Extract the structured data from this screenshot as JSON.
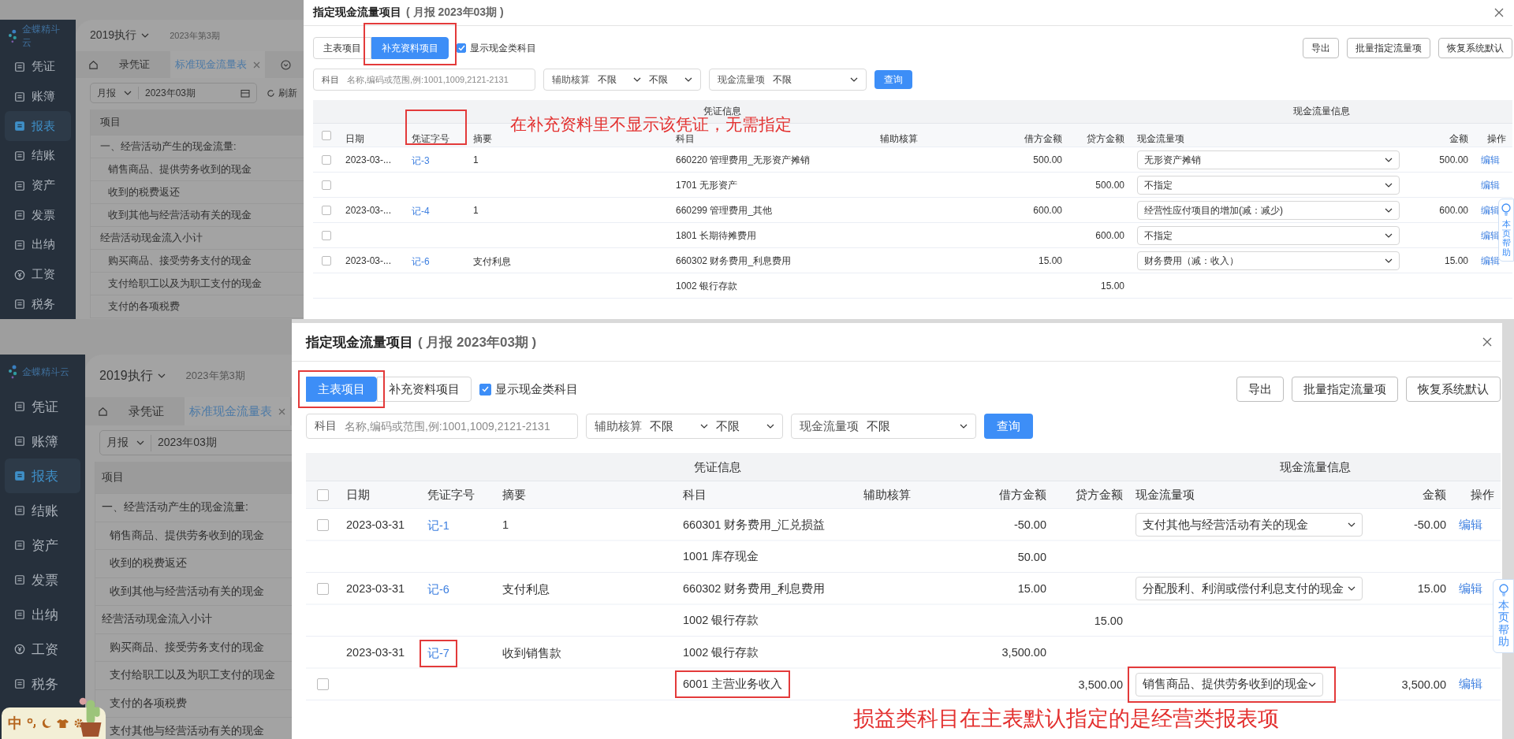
{
  "shots": [
    {
      "app": {
        "logo": "金蝶精斗云",
        "nav": [
          {
            "label": "凭证",
            "selected": false
          },
          {
            "label": "账簿",
            "selected": false
          },
          {
            "label": "报表",
            "selected": true
          },
          {
            "label": "结账",
            "selected": false
          },
          {
            "label": "资产",
            "selected": false
          },
          {
            "label": "发票",
            "selected": false
          },
          {
            "label": "出纳",
            "selected": false
          },
          {
            "label": "工资",
            "selected": false
          },
          {
            "label": "税务",
            "selected": false
          }
        ],
        "book": "2019执行",
        "period": "2023年第3期",
        "tabs": [
          {
            "label": "录凭证",
            "selected": false
          },
          {
            "label": "标准现金流量表",
            "selected": true
          }
        ],
        "report_type": "月报",
        "report_period": "2023年03期",
        "refresh": "刷新",
        "list_header": "项目",
        "items": [
          {
            "label": "一、经营活动产生的现金流量:",
            "kind": "total"
          },
          {
            "label": "销售商品、提供劳务收到的现金",
            "kind": "detail"
          },
          {
            "label": "收到的税费返还",
            "kind": "detail"
          },
          {
            "label": "收到其他与经营活动有关的现金",
            "kind": "detail"
          },
          {
            "label": "经营活动现金流入小计",
            "kind": "total"
          },
          {
            "label": "购买商品、接受劳务支付的现金",
            "kind": "detail"
          },
          {
            "label": "支付给职工以及为职工支付的现金",
            "kind": "detail"
          },
          {
            "label": "支付的各项税费",
            "kind": "detail"
          }
        ]
      },
      "dialog": {
        "title": "指定现金流量项目",
        "subtitle": "( 月报 2023年03期 )",
        "modes": [
          {
            "label": "主表项目",
            "selected": false,
            "marked": false
          },
          {
            "label": "补充资料项目",
            "selected": true,
            "marked": true
          }
        ],
        "show_cash": {
          "label": "显示现金类科目",
          "checked": true
        },
        "actions": [
          "导出",
          "批量指定流量项",
          "恢复系统默认"
        ],
        "filters": {
          "subject_label": "科目",
          "subject_placeholder": "名称,编码或范围,例:1001,1009,2121-2131",
          "aux_label": "辅助核算",
          "aux_values": [
            "不限",
            "不限"
          ],
          "flow_label": "现金流量项",
          "flow_value": "不限",
          "query": "查询"
        },
        "table": {
          "groups": [
            "凭证信息",
            "现金流量信息"
          ],
          "all_checked": false,
          "columns": [
            {
              "label": "日期",
              "marked": false
            },
            {
              "label": "凭证字号",
              "marked": true
            },
            {
              "label": "摘要",
              "marked": false
            },
            {
              "label": "科目",
              "marked": false
            },
            {
              "label": "辅助核算",
              "marked": false
            },
            {
              "label": "借方金额",
              "marked": false
            },
            {
              "label": "贷方金额",
              "marked": false
            },
            {
              "label": "现金流量项",
              "marked": false
            },
            {
              "label": "金额",
              "marked": false
            },
            {
              "label": "操作",
              "marked": false
            }
          ],
          "vouchers": [
            {
              "date": "2023-03-...",
              "number": "记-3",
              "number_marked": false,
              "summary": "1",
              "lines": [
                {
                  "checked": false,
                  "subject": "660220 管理费用_无形资产摊销",
                  "subject_marked": false,
                  "debit": "500.00",
                  "flow": "无形资产摊销",
                  "flow_marked": false,
                  "amount": "500.00",
                  "edit": "编辑"
                },
                {
                  "checked": false,
                  "subject": "1701 无形资产",
                  "subject_marked": false,
                  "credit": "500.00",
                  "flow": "不指定",
                  "flow_marked": false,
                  "edit": "编辑"
                }
              ]
            },
            {
              "date": "2023-03-...",
              "number": "记-4",
              "number_marked": false,
              "summary": "1",
              "lines": [
                {
                  "checked": false,
                  "subject": "660299 管理费用_其他",
                  "subject_marked": false,
                  "debit": "600.00",
                  "flow": "经营性应付项目的增加(减：减少)",
                  "flow_marked": false,
                  "amount": "600.00",
                  "edit": "编辑"
                },
                {
                  "checked": false,
                  "subject": "1801 长期待摊费用",
                  "subject_marked": false,
                  "credit": "600.00",
                  "flow": "不指定",
                  "flow_marked": false,
                  "edit": "编辑"
                }
              ]
            },
            {
              "date": "2023-03-...",
              "number": "记-6",
              "number_marked": false,
              "summary": "支付利息",
              "lines": [
                {
                  "checked": false,
                  "subject": "660302 财务费用_利息费用",
                  "subject_marked": false,
                  "debit": "15.00",
                  "flow": "财务费用（减：收入）",
                  "flow_marked": false,
                  "amount": "15.00",
                  "edit": "编辑"
                },
                {
                  "subject": "1002 银行存款",
                  "subject_marked": false,
                  "credit": "15.00"
                }
              ]
            }
          ]
        },
        "help": "本页帮助",
        "notes": [
          "在补充资料里不显示该凭证，无需指定"
        ]
      }
    },
    {
      "app": {
        "logo": "金蝶精斗云",
        "nav": [
          {
            "label": "凭证",
            "selected": false
          },
          {
            "label": "账簿",
            "selected": false
          },
          {
            "label": "报表",
            "selected": true
          },
          {
            "label": "结账",
            "selected": false
          },
          {
            "label": "资产",
            "selected": false
          },
          {
            "label": "发票",
            "selected": false
          },
          {
            "label": "出纳",
            "selected": false
          },
          {
            "label": "工资",
            "selected": false
          },
          {
            "label": "税务",
            "selected": false
          }
        ],
        "book": "2019执行",
        "period": "2023年第3期",
        "tabs": [
          {
            "label": "录凭证",
            "selected": false
          },
          {
            "label": "标准现金流量表",
            "selected": true
          }
        ],
        "report_type": "月报",
        "report_period": "2023年03期",
        "list_header": "项目",
        "items": [
          {
            "label": "一、经营活动产生的现金流量:",
            "kind": "total"
          },
          {
            "label": "销售商品、提供劳务收到的现金",
            "kind": "detail"
          },
          {
            "label": "收到的税费返还",
            "kind": "detail"
          },
          {
            "label": "收到其他与经营活动有关的现金",
            "kind": "detail"
          },
          {
            "label": "经营活动现金流入小计",
            "kind": "total"
          },
          {
            "label": "购买商品、接受劳务支付的现金",
            "kind": "detail"
          },
          {
            "label": "支付给职工以及为职工支付的现金",
            "kind": "detail"
          },
          {
            "label": "支付的各项税费",
            "kind": "detail"
          },
          {
            "label": "支付其他与经营活动有关的现金",
            "kind": "detail"
          }
        ],
        "ime": "中"
      },
      "dialog": {
        "title": "指定现金流量项目",
        "subtitle": "( 月报 2023年03期 )",
        "modes": [
          {
            "label": "主表项目",
            "selected": true,
            "marked": true
          },
          {
            "label": "补充资料项目",
            "selected": false,
            "marked": false
          }
        ],
        "show_cash": {
          "label": "显示现金类科目",
          "checked": true
        },
        "actions": [
          "导出",
          "批量指定流量项",
          "恢复系统默认"
        ],
        "filters": {
          "subject_label": "科目",
          "subject_placeholder": "名称,编码或范围,例:1001,1009,2121-2131",
          "aux_label": "辅助核算",
          "aux_values": [
            "不限",
            "不限"
          ],
          "flow_label": "现金流量项",
          "flow_value": "不限",
          "query": "查询"
        },
        "table": {
          "groups": [
            "凭证信息",
            "现金流量信息"
          ],
          "all_checked": false,
          "columns": [
            {
              "label": "日期",
              "marked": false
            },
            {
              "label": "凭证字号",
              "marked": false
            },
            {
              "label": "摘要",
              "marked": false
            },
            {
              "label": "科目",
              "marked": false
            },
            {
              "label": "辅助核算",
              "marked": false
            },
            {
              "label": "借方金额",
              "marked": false
            },
            {
              "label": "贷方金额",
              "marked": false
            },
            {
              "label": "现金流量项",
              "marked": false
            },
            {
              "label": "金额",
              "marked": false
            },
            {
              "label": "操作",
              "marked": false
            }
          ],
          "vouchers": [
            {
              "date": "2023-03-31",
              "number": "记-1",
              "number_marked": false,
              "summary": "1",
              "lines": [
                {
                  "checked": false,
                  "subject": "660301 财务费用_汇兑损益",
                  "subject_marked": false,
                  "debit": "-50.00",
                  "flow": "支付其他与经营活动有关的现金",
                  "flow_marked": false,
                  "amount": "-50.00",
                  "edit": "编辑"
                },
                {
                  "subject": "1001 库存现金",
                  "subject_marked": false,
                  "debit": "50.00"
                }
              ]
            },
            {
              "date": "2023-03-31",
              "number": "记-6",
              "number_marked": false,
              "summary": "支付利息",
              "lines": [
                {
                  "checked": false,
                  "subject": "660302 财务费用_利息费用",
                  "subject_marked": false,
                  "debit": "15.00",
                  "flow": "分配股利、利润或偿付利息支付的现金",
                  "flow_marked": false,
                  "amount": "15.00",
                  "edit": "编辑"
                },
                {
                  "subject": "1002 银行存款",
                  "subject_marked": false,
                  "credit": "15.00"
                }
              ]
            },
            {
              "date": "2023-03-31",
              "number": "记-7",
              "number_marked": true,
              "summary": "收到销售款",
              "lines": [
                {
                  "subject": "1002 银行存款",
                  "subject_marked": false,
                  "debit": "3,500.00"
                },
                {
                  "checked": false,
                  "subject": "6001 主营业务收入",
                  "subject_marked": true,
                  "credit": "3,500.00",
                  "flow": "销售商品、提供劳务收到的现金",
                  "flow_marked": true,
                  "amount": "3,500.00",
                  "edit": "编辑"
                }
              ]
            }
          ]
        },
        "help": "本页帮助",
        "notes": [
          "损益类科目在主表默认指定的是经营类报表项"
        ]
      }
    }
  ]
}
